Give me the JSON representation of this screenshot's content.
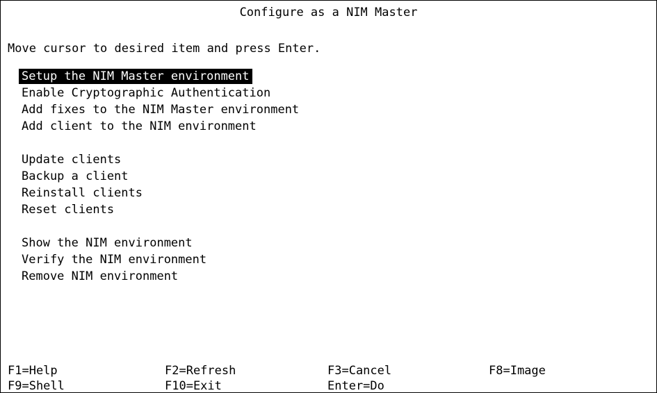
{
  "screen": {
    "title": "Configure as a NIM Master",
    "instructions": "Move cursor to desired item and press Enter."
  },
  "menu": {
    "groups": [
      {
        "items": [
          {
            "label": "Setup the NIM Master environment",
            "selected": true
          },
          {
            "label": "Enable Cryptographic Authentication"
          },
          {
            "label": "Add fixes to the NIM Master environment"
          },
          {
            "label": "Add client to the NIM environment"
          }
        ]
      },
      {
        "items": [
          {
            "label": "Update clients"
          },
          {
            "label": "Backup a client"
          },
          {
            "label": "Reinstall clients"
          },
          {
            "label": "Reset clients"
          }
        ]
      },
      {
        "items": [
          {
            "label": "Show the NIM environment"
          },
          {
            "label": "Verify the NIM environment"
          },
          {
            "label": "Remove NIM environment"
          }
        ]
      }
    ]
  },
  "function_keys": {
    "row1": [
      "F1=Help",
      "F2=Refresh",
      "F3=Cancel",
      "F8=Image"
    ],
    "row2": [
      "F9=Shell",
      "F10=Exit",
      "Enter=Do"
    ]
  },
  "colors": {
    "background": "#ffffff",
    "text": "#000000",
    "highlight_background": "#000000",
    "highlight_text": "#ffffff"
  }
}
